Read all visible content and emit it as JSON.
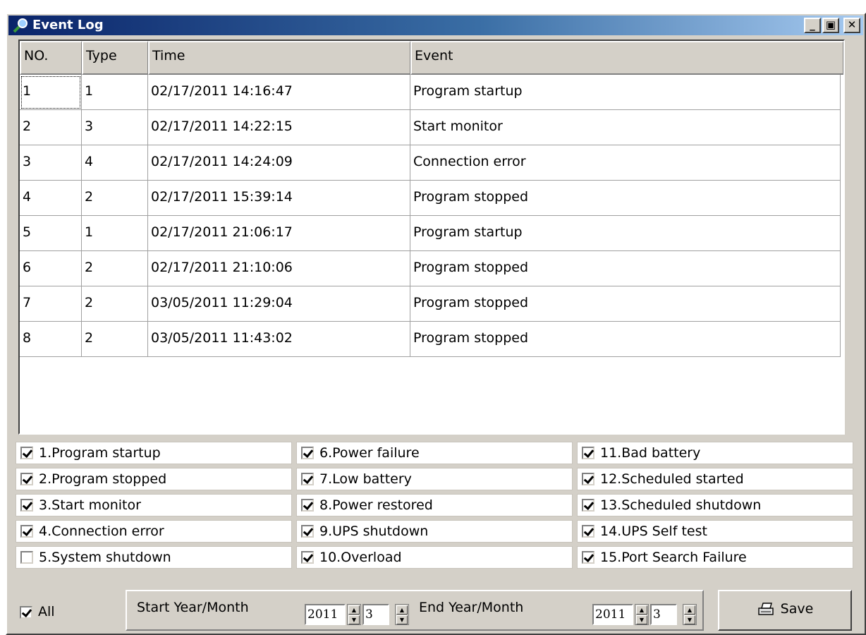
{
  "window": {
    "title": "Event Log",
    "controls": {
      "minimize": "_",
      "maximize": "▣",
      "close": "✕"
    }
  },
  "table": {
    "columns": [
      "NO.",
      "Type",
      "Time",
      "Event"
    ],
    "rows": [
      {
        "no": "1",
        "type": "1",
        "time": "02/17/2011 14:16:47",
        "event": "Program startup"
      },
      {
        "no": "2",
        "type": "3",
        "time": "02/17/2011 14:22:15",
        "event": "Start monitor"
      },
      {
        "no": "3",
        "type": "4",
        "time": "02/17/2011 14:24:09",
        "event": "Connection error"
      },
      {
        "no": "4",
        "type": "2",
        "time": "02/17/2011 15:39:14",
        "event": "Program stopped"
      },
      {
        "no": "5",
        "type": "1",
        "time": "02/17/2011 21:06:17",
        "event": "Program startup"
      },
      {
        "no": "6",
        "type": "2",
        "time": "02/17/2011 21:10:06",
        "event": "Program stopped"
      },
      {
        "no": "7",
        "type": "2",
        "time": "03/05/2011 11:29:04",
        "event": "Program stopped"
      },
      {
        "no": "8",
        "type": "2",
        "time": "03/05/2011 11:43:02",
        "event": "Program stopped"
      }
    ]
  },
  "filters": [
    {
      "label": "1.Program startup",
      "checked": true
    },
    {
      "label": "2.Program stopped",
      "checked": true
    },
    {
      "label": "3.Start monitor",
      "checked": true
    },
    {
      "label": "4.Connection error",
      "checked": true
    },
    {
      "label": "5.System shutdown",
      "checked": false
    },
    {
      "label": "6.Power failure",
      "checked": true
    },
    {
      "label": "7.Low battery",
      "checked": true
    },
    {
      "label": "8.Power restored",
      "checked": true
    },
    {
      "label": "9.UPS shutdown",
      "checked": true
    },
    {
      "label": "10.Overload",
      "checked": true
    },
    {
      "label": "11.Bad battery",
      "checked": true
    },
    {
      "label": "12.Scheduled started",
      "checked": true
    },
    {
      "label": "13.Scheduled shutdown",
      "checked": true
    },
    {
      "label": "14.UPS Self test",
      "checked": true
    },
    {
      "label": "15.Port Search Failure",
      "checked": true
    }
  ],
  "bottom": {
    "all": {
      "label": "All",
      "checked": true
    },
    "start_label": "Start Year/Month",
    "start_year": "2011",
    "start_month": "3",
    "end_label": "End Year/Month",
    "end_year": "2011",
    "end_month": "3",
    "save_label": "Save"
  }
}
